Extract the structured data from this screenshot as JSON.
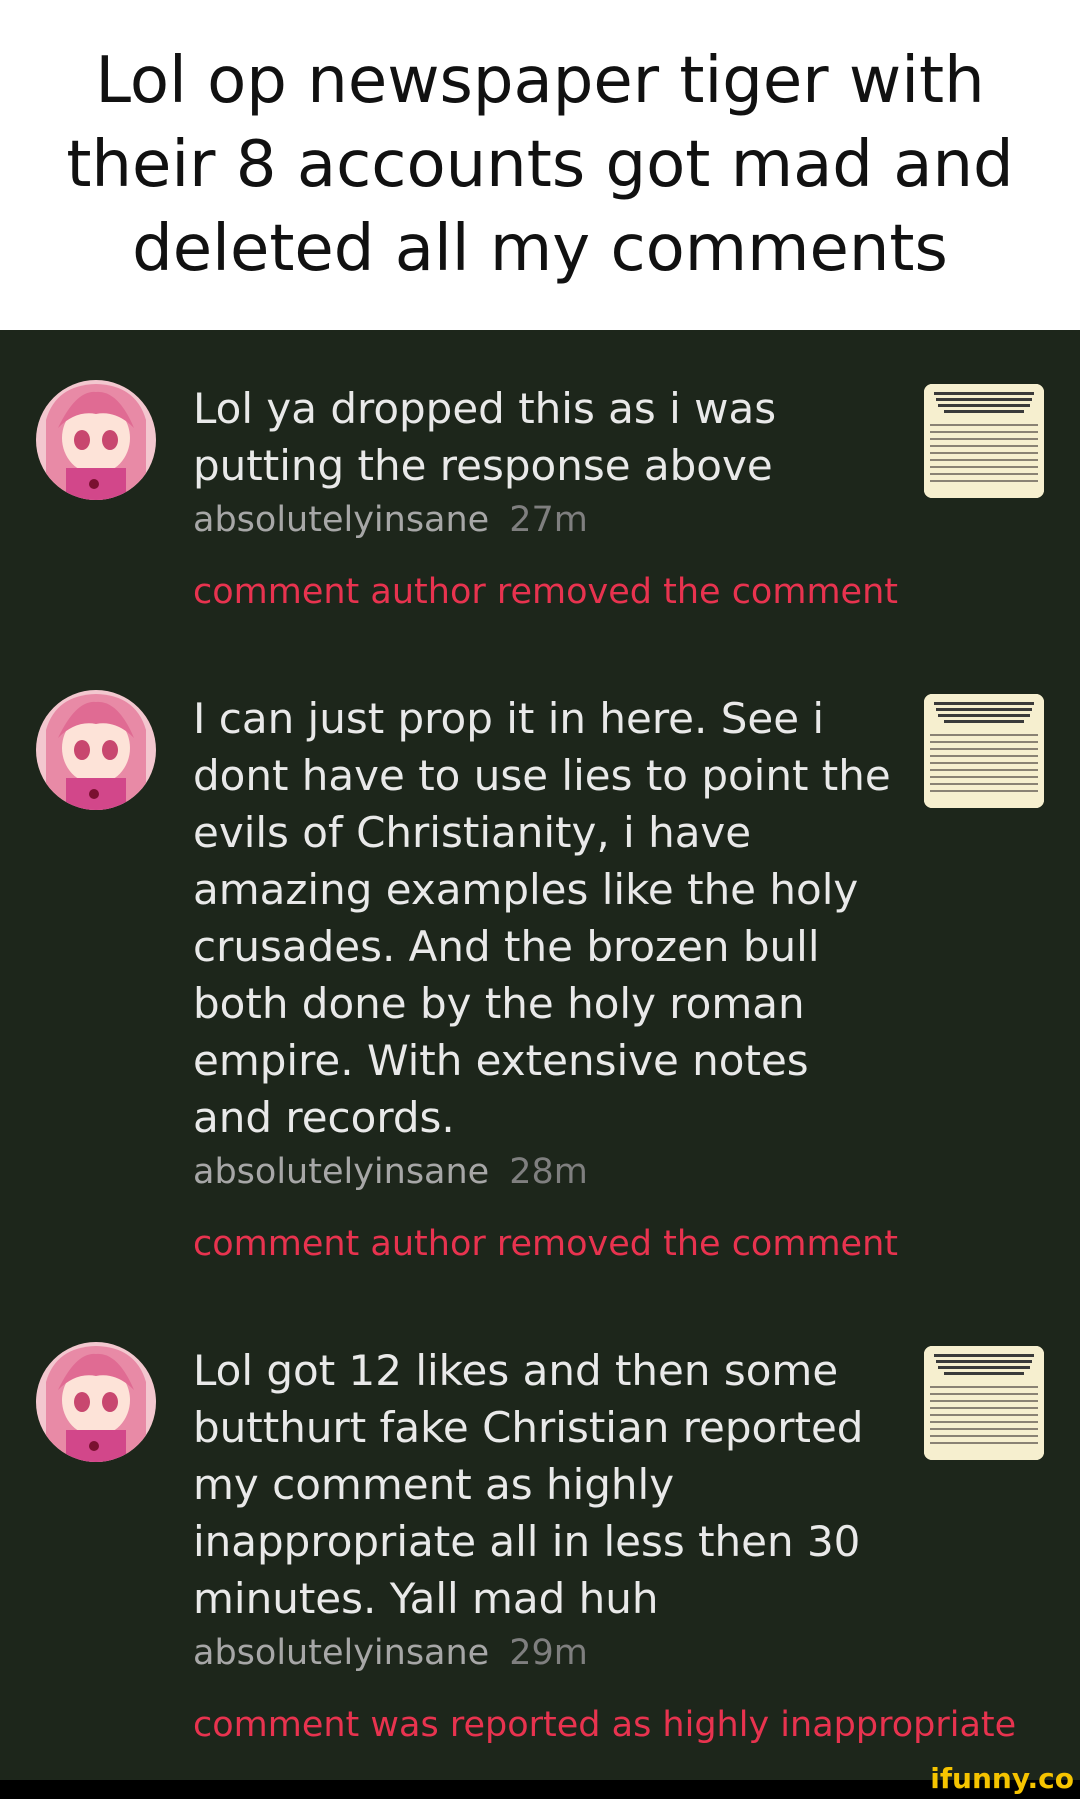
{
  "caption": "Lol op newspaper tiger with their 8 accounts got mad and deleted all my comments",
  "comments": [
    {
      "text": "Lol ya dropped this as i was putting the response above",
      "author": "absolutelyinsane",
      "time": "27m",
      "notice": "comment author removed the comment"
    },
    {
      "text": "I can just prop it in here. See i dont have to use lies to point the evils of Christianity, i have amazing examples like the holy crusades. And the brozen bull both done by the holy roman empire. With extensive notes and records.",
      "author": "absolutelyinsane",
      "time": "28m",
      "notice": "comment author removed the comment"
    },
    {
      "text": "Lol got 12 likes and then some butthurt fake Christian reported my comment as highly inappropriate all in less then 30 minutes. Yall mad huh",
      "author": "absolutelyinsane",
      "time": "29m",
      "notice": "comment was reported as highly inappropriate"
    }
  ],
  "watermark": "ifunny.co",
  "colors": {
    "panel_bg": "#1d261b",
    "comment_text": "#e9e9e9",
    "author": "#a7a7a7",
    "time": "#7f7f7f",
    "notice": "#e8334f",
    "watermark": "#f6c400"
  },
  "icons": {
    "avatar": "anime-avatar-icon",
    "thumbnail": "news-clipping-thumbnail"
  }
}
